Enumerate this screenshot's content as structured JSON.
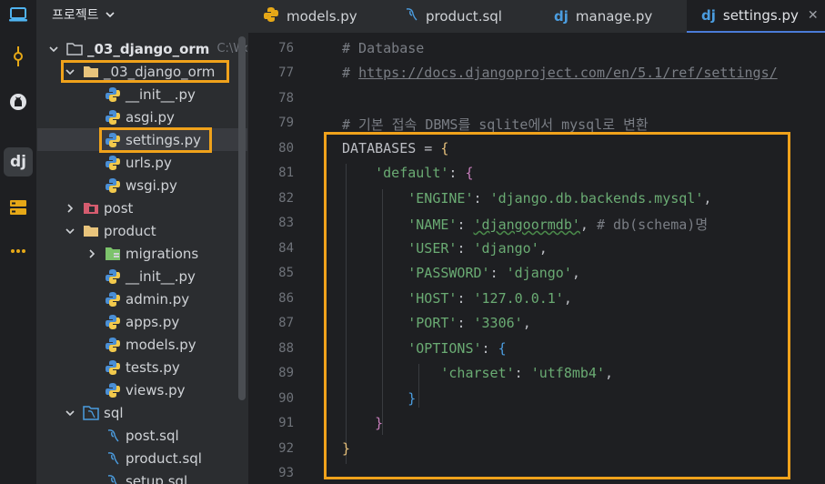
{
  "project_header": {
    "title": "프로젝트"
  },
  "tree": {
    "root": {
      "name": "_03_django_orm",
      "hint": "C:\\Wo"
    },
    "app_folder": {
      "name": "_03_django_orm"
    },
    "app_files": [
      "__init__.py",
      "asgi.py",
      "settings.py",
      "urls.py",
      "wsgi.py"
    ],
    "post": "post",
    "product": "product",
    "migrations": "migrations",
    "product_files": [
      "__init__.py",
      "admin.py",
      "apps.py",
      "models.py",
      "tests.py",
      "views.py"
    ],
    "sql": "sql",
    "sql_files": [
      "post.sql",
      "product.sql",
      "setup.sql"
    ]
  },
  "tabs": [
    {
      "label": "models.py"
    },
    {
      "label": "product.sql"
    },
    {
      "label": "manage.py"
    },
    {
      "label": "settings.py"
    }
  ],
  "line_numbers": [
    "76",
    "77",
    "78",
    "79",
    "80",
    "81",
    "82",
    "83",
    "84",
    "85",
    "86",
    "87",
    "88",
    "89",
    "90",
    "91",
    "92",
    "93"
  ],
  "code": {
    "l76": "# Database",
    "l77": "https://docs.djangoproject.com/en/5.1/ref/settings/",
    "l77_prefix": "# ",
    "l79": "# 기본 접속 DBMS를 sqlite에서 mysql로 변환",
    "l80_key": "DATABASES",
    "l80_op": " = ",
    "l81_key": "'default'",
    "l82_key": "'ENGINE'",
    "l82_val": "'django.db.backends.mysql'",
    "l83_key": "'NAME'",
    "l83_val": "'djangoormdb'",
    "l83_cmt": "# db(schema)명",
    "l84_key": "'USER'",
    "l84_val": "'django'",
    "l85_key": "'PASSWORD'",
    "l85_val": "'django'",
    "l86_key": "'HOST'",
    "l86_val": "'127.0.0.1'",
    "l87_key": "'PORT'",
    "l87_val": "'3306'",
    "l88_key": "'OPTIONS'",
    "l89_key": "'charset'",
    "l89_val": "'utf8mb4'"
  },
  "colors": {
    "highlight": "#f0a21b",
    "string": "#6aab73",
    "comment": "#7a7e85"
  }
}
